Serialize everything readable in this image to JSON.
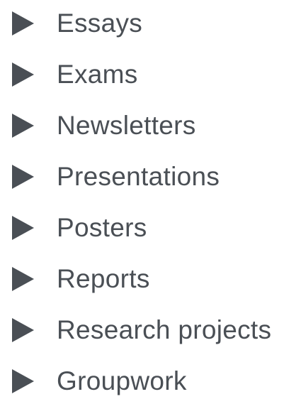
{
  "list": {
    "items": [
      {
        "label": "Essays",
        "icon": "triangle-right-icon"
      },
      {
        "label": "Exams",
        "icon": "triangle-right-icon"
      },
      {
        "label": "Newsletters",
        "icon": "triangle-right-icon"
      },
      {
        "label": "Presentations",
        "icon": "triangle-right-icon"
      },
      {
        "label": "Posters",
        "icon": "triangle-right-icon"
      },
      {
        "label": "Reports",
        "icon": "triangle-right-icon"
      },
      {
        "label": "Research projects",
        "icon": "triangle-right-icon"
      },
      {
        "label": "Groupwork",
        "icon": "triangle-right-icon"
      }
    ]
  },
  "colors": {
    "text": "#4a4f55",
    "background": "#ffffff"
  }
}
